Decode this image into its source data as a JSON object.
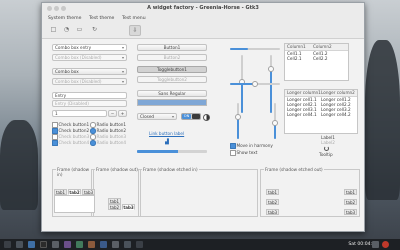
{
  "window": {
    "title": "A widget factory - Greenia-Horse - Gtk3"
  },
  "menubar": {
    "items": [
      "System theme",
      "Test theme",
      "Test menu"
    ]
  },
  "left": {
    "combo1": "Combo box entry",
    "combo2": "Combo box (Disabled)",
    "combo3": "Combo box",
    "combo4": "Combo box (Disabled)",
    "entry1": "Entry",
    "entry2": "Entry (Disabled)",
    "spin_value": "1",
    "checks": [
      {
        "label": "Check button1",
        "checked": false
      },
      {
        "label": "Check button2",
        "checked": true
      },
      {
        "label": "Check button3",
        "checked": false
      },
      {
        "label": "Check button4",
        "checked": true
      }
    ],
    "radios": [
      {
        "label": "Radio button1",
        "checked": false
      },
      {
        "label": "Radio button2",
        "checked": true
      },
      {
        "label": "Radio button3",
        "checked": false
      },
      {
        "label": "Radio button4",
        "checked": true
      }
    ]
  },
  "center": {
    "button1": "Button1",
    "button2": "Button2",
    "toggle1": "Togglebutton1",
    "toggle2": "Togglebutton2",
    "font_label": "Sans Regular",
    "closed_label": "Closed",
    "switch_state": "ON",
    "link_label": "Link button label",
    "progress": 0.58
  },
  "sliders": {
    "checkbox_label": "Move in harmony",
    "show_text_label": "Show text"
  },
  "lists": {
    "list1": {
      "headers": [
        "Column1",
        "Column2"
      ],
      "rows": [
        [
          "Cell1.1",
          "Cell1.2"
        ],
        [
          "Cell2.1",
          "Cell2.2"
        ]
      ]
    },
    "list2": {
      "headers": [
        "Longer column1",
        "Longer column2"
      ],
      "rows": [
        [
          "Longer cell1.1",
          "Longer cell1.2"
        ],
        [
          "Longer cell2.1",
          "Longer cell2.2"
        ],
        [
          "Longer cell3.1",
          "Longer cell3.2"
        ],
        [
          "Longer cell4.1",
          "Longer cell4.2"
        ]
      ]
    },
    "label1": "Label1",
    "label2": "Label2",
    "spinner_label": "Tooltip"
  },
  "frames": {
    "f1": "Frame (shadow in)",
    "f2": "Frame (shadow out)",
    "f3": "Frame (shadow etched in)",
    "f4": "Frame (shadow etched out)"
  },
  "tabs": {
    "set1": [
      "tab1",
      "tab2",
      "tab3"
    ],
    "set2": [
      "tab1",
      "tab2",
      "tab3"
    ],
    "set3": [
      "tab1",
      "tab2",
      "tab3"
    ],
    "set4": [
      "tab1",
      "tab2",
      "tab3"
    ]
  },
  "taskbar": {
    "clock": "Sat 00:04:32"
  },
  "colors": {
    "accent": "#4a90d9"
  }
}
